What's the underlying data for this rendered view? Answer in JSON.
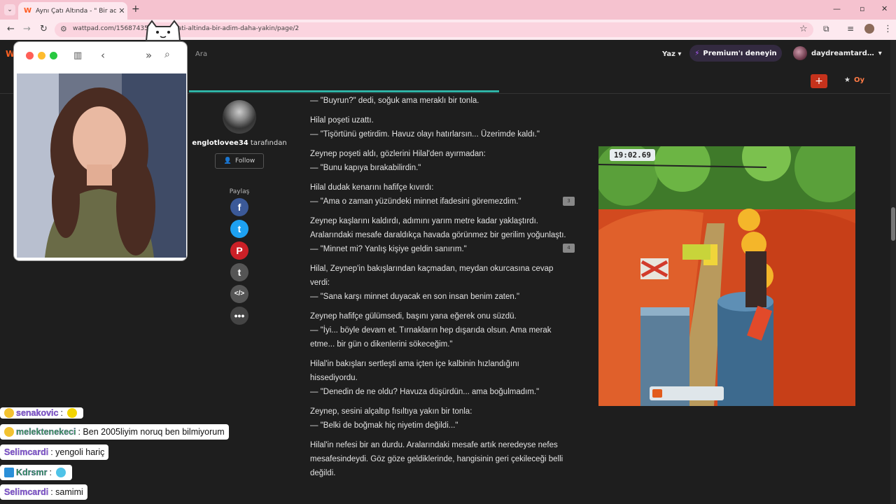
{
  "browser": {
    "tab_title": "Aynı Çatı Altında - \" Bir adım d…",
    "favicon": "W",
    "url": "wattpad.com/1568743592-ayni-cati-altinda-bir-adim-daha-yakin/page/2",
    "accent": "#f5c2cf"
  },
  "site_nav": {
    "search_label": "Ara",
    "write_label": "Yaz",
    "premium_label": "Premium'ı deneyin",
    "username": "daydreamtard…",
    "vote_label": "Oy",
    "add_label": "+"
  },
  "author": {
    "name": "englotlovee34",
    "by_suffix": " tarafından",
    "follow_label": "Follow",
    "share_label": "Paylaş",
    "share_icons": [
      "facebook-icon",
      "twitter-icon",
      "pinterest-icon",
      "tumblr-icon",
      "embed-icon",
      "more-icon"
    ]
  },
  "story": {
    "lines": [
      "— \"Buyrun?\" dedi, soğuk ama meraklı bir tonla.",
      "",
      "Hilal poşeti uzattı.",
      "— \"Tişörtünü getirdim. Havuz olayı hatırlarsın... Üzerimde kaldı.\"",
      "",
      "Zeynep poşeti aldı, gözlerini Hilal'den ayırmadan:",
      "— \"Bunu kapıya bırakabilirdin.\"",
      "",
      "Hilal dudak kenarını hafifçe kıvırdı:",
      "— \"Ama o zaman yüzündeki minnet ifadesini göremezdim.\"",
      "",
      "Zeynep kaşlarını kaldırdı, adımını yarım metre kadar yaklaştırdı.",
      "Aralarındaki mesafe daraldıkça havada görünmez bir gerilim yoğunlaştı.",
      "— \"Minnet mi? Yanlış kişiye geldin sanırım.\"",
      "",
      "Hilal, Zeynep'in bakışlarından kaçmadan, meydan okurcasına cevap",
      "verdi:",
      "— \"Sana karşı minnet duyacak en son insan benim zaten.\"",
      "",
      "Zeynep hafifçe gülümsedi, başını yana eğerek onu süzdü.",
      "— \"İyi... böyle devam et. Tırnakların hep dışarıda olsun. Ama merak",
      "etme... bir gün o dikenlerini sökeceğim.\"",
      "",
      "Hilal'in bakışları sertleşti ama içten içe kalbinin hızlandığını",
      "hissediyordu.",
      "— \"Denedin de ne oldu? Havuza düşürdün... ama boğulmadım.\"",
      "",
      "Zeynep, sesini alçaltıp fısıltıya yakın bir tonla:",
      "— \"Belki de boğmak hiç niyetim değildi...\"",
      "",
      "Hilal'in nefesi bir an durdu. Aralarındaki mesafe artık neredeyse nefes",
      "mesafesindeydi. Göz göze geldiklerinde, hangisinin geri çekileceği belli",
      "değildi."
    ],
    "comment_counts": [
      "3",
      "4"
    ]
  },
  "game": {
    "timer": "19:02.69"
  },
  "chat": [
    {
      "name": "senakovic",
      "message": ":"
    },
    {
      "name": "melektenekeci",
      "message": ": Ben 2005liyim noruq ben bilmiyorum"
    },
    {
      "name": "Selimcardi",
      "message": ": yengoli hariç"
    },
    {
      "name": "Kdrsmr",
      "message": ":"
    },
    {
      "name": "Selimcardi",
      "message": ": samimi"
    }
  ]
}
